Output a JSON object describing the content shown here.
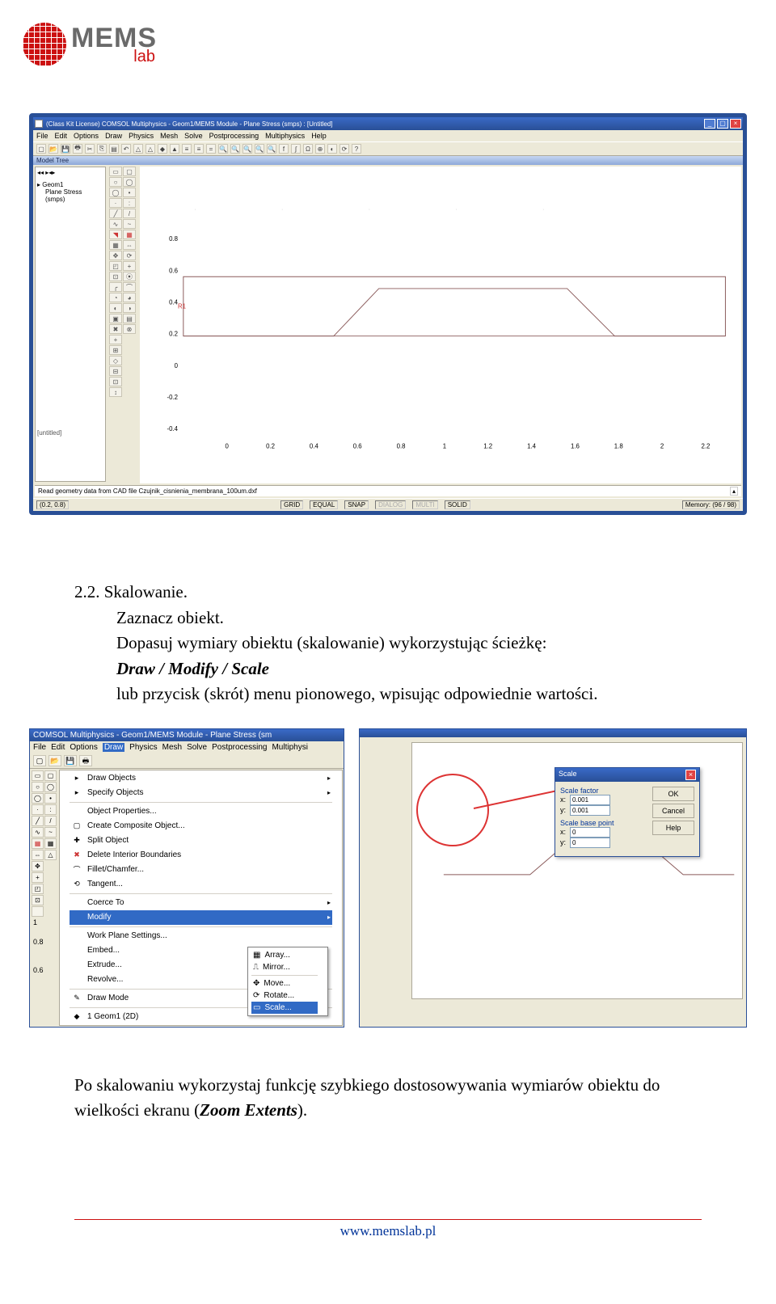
{
  "logo": {
    "mems": "MEMS",
    "lab": "lab"
  },
  "comsol": {
    "title": "(Class Kit License) COMSOL Multiphysics - Geom1/MEMS Module - Plane Stress (smps) : [Untitled]",
    "menus": [
      "File",
      "Edit",
      "Options",
      "Draw",
      "Physics",
      "Mesh",
      "Solve",
      "Postprocessing",
      "Multiphysics",
      "Help"
    ],
    "sub_title": "Model Tree",
    "tree": {
      "root": "Geom1",
      "child": "Plane Stress (smps)"
    },
    "untitled": "[untitled]",
    "xticks": [
      "0",
      "0.2",
      "0.4",
      "0.6",
      "0.8",
      "1",
      "1.2",
      "1.4",
      "1.6",
      "1.8",
      "2",
      "2.2"
    ],
    "yticks": [
      "-0.4",
      "-0.2",
      "0",
      "0.2",
      "0.4",
      "0.6",
      "0.8"
    ],
    "r1label": "R1",
    "status_msg": "Read geometry data from CAD file Czujnik_cisnienia_membrana_100um.dxf",
    "coords": "(0.2, 0.8)",
    "flags": [
      "GRID",
      "EQUAL",
      "SNAP",
      "DIALOG",
      "MULTI",
      "SOLID"
    ],
    "memory": "Memory: (96 / 98)"
  },
  "section": {
    "num": "2.2. Skalowanie.",
    "l1": "Zaznacz obiekt.",
    "l2a": "Dopasuj wymiary obiektu (skalowanie) wykorzystując ścieżkę:",
    "l2b": "Draw / Modify / Scale",
    "l3": "lub przycisk (skrót) menu pionowego, wpisując odpowiednie wartości."
  },
  "shot_left": {
    "title": "COMSOL Multiphysics - Geom1/MEMS Module - Plane Stress (sm",
    "menus": [
      "File",
      "Edit",
      "Options",
      "Draw",
      "Physics",
      "Mesh",
      "Solve",
      "Postprocessing",
      "Multiphysi"
    ],
    "items": [
      {
        "icon": "▸",
        "label": "Draw Objects",
        "arrow": "▸"
      },
      {
        "icon": "▸",
        "label": "Specify Objects",
        "arrow": "▸"
      },
      {
        "icon": "",
        "label": "Object Properties..."
      },
      {
        "icon": "▢",
        "label": "Create Composite Object..."
      },
      {
        "icon": "✚",
        "label": "Split Object"
      },
      {
        "icon": "✖",
        "label": "Delete Interior Boundaries"
      },
      {
        "icon": "⌒",
        "label": "Fillet/Chamfer..."
      },
      {
        "icon": "⟲",
        "label": "Tangent..."
      },
      {
        "icon": "",
        "label": "Coerce To",
        "arrow": "▸"
      }
    ],
    "modify": "Modify",
    "items2": [
      {
        "icon": "",
        "label": "Work Plane Settings..."
      },
      {
        "icon": "",
        "label": "Embed..."
      },
      {
        "icon": "",
        "label": "Extrude..."
      },
      {
        "icon": "",
        "label": "Revolve..."
      },
      {
        "icon": "✎",
        "label": "Draw Mode"
      },
      {
        "icon": "◆",
        "label": "1 Geom1 (2D)"
      }
    ],
    "sub": [
      {
        "icon": "▦",
        "label": "Array..."
      },
      {
        "icon": "⎍",
        "label": "Mirror..."
      },
      {
        "icon": "✥",
        "label": "Move..."
      },
      {
        "icon": "⟳",
        "label": "Rotate..."
      },
      {
        "icon": "▭",
        "label": "Scale...",
        "hl": true
      }
    ],
    "side_nums": [
      "1",
      "0.8",
      "0.6"
    ]
  },
  "shot_right": {
    "dlg_title": "Scale",
    "grp1": "Scale factor",
    "grp2": "Scale base point",
    "x": "x:",
    "y": "y:",
    "v1": "0.001",
    "v2": "0.001",
    "v3": "0",
    "v4": "0",
    "btns": [
      "OK",
      "Cancel",
      "Help"
    ]
  },
  "p2": "Po skalowaniu wykorzystaj funkcję szybkiego dostosowywania wymiarów obiektu do wielkości ekranu (",
  "p2_em": "Zoom Extents",
  "p2_end": ").",
  "footer": "www.memslab.pl"
}
